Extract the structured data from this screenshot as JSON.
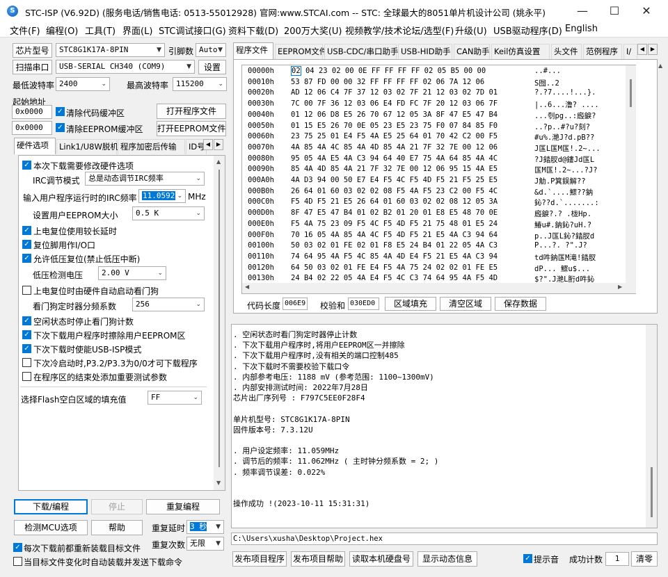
{
  "title": "STC-ISP (V6.92D) (服务电话/销售电话: 0513-55012928) 官网:www.STCAI.com  -- STC: 全球最大的8051单片机设计公司 (姚永平)",
  "menu": [
    "文件(F)",
    "编程(O)",
    "工具(T)",
    "界面(L)",
    "STC调试接口(G)",
    "资料下载(D)",
    "200万大奖(U)",
    "视频教学/技术论坛/选型(F)",
    "升级(U)",
    "USB驱动程序(D)",
    "English"
  ],
  "left": {
    "chip_btn": "芯片型号",
    "chip_value": "STC8G1K17A-8PIN",
    "pins_label": "引脚数",
    "pins_value": "Auto",
    "scan_btn": "扫描串口",
    "port_value": "USB-SERIAL CH340 (COM9)",
    "settings_btn": "设置",
    "min_baud_label": "最低波特率",
    "min_baud": "2400",
    "max_baud_label": "最高波特率",
    "max_baud": "115200",
    "start_addr_label": "起始地址",
    "addr1": "0x0000",
    "clear_code": "清除代码缓冲区",
    "open_prog": "打开程序文件",
    "addr2": "0x0000",
    "clear_eeprom": "清除EEPROM缓冲区",
    "open_eeprom": "打开EEPROM文件",
    "tabs": [
      "硬件选项",
      "Link1/U8W脱机",
      "程序加密后传输",
      "ID号"
    ],
    "hw": {
      "opt1": "本次下载需要修改硬件选项",
      "irc_mode_label": "IRC调节模式",
      "irc_mode": "总是动态调节IRC频率",
      "irc_freq_label": "输入用户程序运行时的IRC频率",
      "irc_freq": "11.0592",
      "mhz": "MHz",
      "eeprom_label": "设置用户EEPROM大小",
      "eeprom": "0.5 K",
      "opt2": "上电复位使用较长延时",
      "opt3": "复位脚用作I/O口",
      "opt4": "允许低压复位(禁止低压中断)",
      "lv_label": "低压检测电压",
      "lv": "2.00 V",
      "opt5": "上电复位时由硬件自动启动看门狗",
      "wdt_label": "看门狗定时器分频系数",
      "wdt": "256",
      "opt6": "空闲状态时停止看门狗计数",
      "opt7": "下次下载用户程序时擦除用户EEPROM区",
      "opt8": "下次下载时使能USB-ISP模式",
      "opt9": "下次冷启动时,P3.2/P3.3为0/0才可下载程序",
      "opt10": "在程序区的结束处添加重要测试参数",
      "fill_label": "选择Flash空白区域的填充值",
      "fill": "FF"
    },
    "download_btn": "下载/编程",
    "stop_btn": "停止",
    "reprog_btn": "重复编程",
    "check_btn": "检测MCU选项",
    "help_btn": "帮助",
    "delay_label": "重复延时",
    "delay": "3 秒",
    "count_label": "重复次数",
    "count": "无限",
    "reload": "每次下载前都重新装载目标文件",
    "autosend": "当目标文件变化时自动装载并发送下载命令"
  },
  "right": {
    "tabs": [
      "程序文件",
      "EEPROM文件",
      "USB-CDC/串口助手",
      "USB-HID助手",
      "CAN助手",
      "Keil仿真设置",
      "头文件",
      "范例程序",
      "I/"
    ],
    "hex": [
      [
        "00000h",
        "02 04 23 02 00 0E FF FF FF FF 02 05 B5 00 00",
        "..#..."
      ],
      [
        "00010h",
        "53 87 FD 00 00 32 FF FF FF FF 02 06 7A 12 06",
        "S囫..2"
      ],
      [
        "00020h",
        "AD 12 06 C4 7F 37 12 03 02 7F 21 12 03 02 7D 01",
        "?.?7....!...}."
      ],
      [
        "00030h",
        "7C 00 7F 36 12 03 06 E4 FD FC 7F 20 12 03 06 7F",
        "|..6...澛? ...."
      ],
      [
        "00040h",
        "01 12 06 D8 E5 26 70 67 12 05 3A 8F 47 E5 47 B4",
        "...刳pg..:廏錑?"
      ],
      [
        "00050h",
        "01 15 E5 26 70 0E 05 23 E5 23 75 F0 07 84 85 F0",
        "..?p..#?u?刻?"
      ],
      [
        "00060h",
        "23 75 25 01 E4 F5 4A E5 25 64 01 70 42 C2 00 F5",
        "#u%.滟J?d.pB??"
      ],
      [
        "00070h",
        "4A 85 4A 4C 85 4A 4D 85 4A 21 7F 32 7E 00 12 06",
        "J匤L匤M匤!.2~..."
      ],
      [
        "00080h",
        "95 05 4A E5 4A C3 94 64 40 E7 75 4A 64 85 4A 4C",
        "?J錔肞d@鏤Jd匤L"
      ],
      [
        "00090h",
        "85 4A 4D 85 4A 21 7F 32 7E 00 12 06 95 15 4A E5",
        "匤M匤!.2~...?J?"
      ],
      [
        "000A0h",
        "4A D3 94 00 50 E7 E4 F5 4C F5 4D F5 21 F5 25 E5",
        "J觔.P箕鋘解??"
      ],
      [
        "000B0h",
        "26 64 01 60 03 02 02 08 F5 4A F5 23 C2 00 F5 4C",
        "&d.`....鰥??鈉"
      ],
      [
        "000C0h",
        "F5 4D F5 21 E5 26 64 01 60 03 02 02 08 12 05 3A",
        "鈊??d.`.......:"
      ],
      [
        "000D0h",
        "8F 47 E5 47 B4 01 02 B2 01 20 01 E8 E5 48 70 0E",
        "廏錑?.? .栊Hp."
      ],
      [
        "000E0h",
        "F5 4A 75 23 09 F5 4C F5 4D F5 21 75 48 01 E5 24",
        "鰆u#.鈉鈊?uH.?"
      ],
      [
        "000F0h",
        "70 16 05 4A 85 4A 4C F5 4D F5 21 E5 4A C3 94 64",
        "p..J匤L鈊?錔肞d"
      ],
      [
        "00100h",
        "50 03 02 01 FE 02 01 F8 E5 24 B4 01 22 05 4A C3",
        "P...?.  ?\".J?"
      ],
      [
        "00110h",
        "74 64 95 4A F5 4C 85 4A 4D E4 F5 21 E5 4A C3 94",
        "td吽鈉匤M滝!錔肞"
      ],
      [
        "00120h",
        "64 50 03 02 01 FE E4 F5 4A 75 24 02 02 01 FE E5",
        "dP...  鰥u$..."
      ],
      [
        "00130h",
        "24 B4 02 22 05 4A E4 F5 4C C3 74 64 95 4A F5 4D",
        "$?\".J滟L胻d吽鈊"
      ]
    ],
    "code_len_label": "代码长度",
    "code_len": "006E9",
    "checksum_label": "校验和",
    "checksum": "030ED0",
    "fill_btn": "区域填充",
    "clear_btn": "清空区域",
    "save_btn": "保存数据",
    "log": [
      ". 空闲状态时看门狗定时器停止计数",
      ". 下次下载用户程序时,将用户EEPROM区一并擦除",
      ". 下次下载用户程序时,没有相关的端口控制485",
      ". 下次下载时不需要校验下载口令",
      ". 内部参考电压: 1188 mV (参考范围: 1100~1300mV)",
      ". 内部安排测试时间: 2022年7月28日",
      "芯片出厂序列号 : F797C5EE0F28F4",
      "",
      "  单片机型号: STC8G1K17A-8PIN",
      "  固件版本号: 7.3.12U",
      "",
      ". 用户设定频率: 11.059MHz",
      ". 调节后的频率: 11.062MHz ( 主时钟分频系数 = 2; )",
      ". 频率调节误差: 0.022%",
      "",
      "",
      "操作成功 !(2023-10-11 15:31:31)"
    ],
    "path": "C:\\Users\\xusha\\Desktop\\Project.hex",
    "publish_btn": "发布项目程序",
    "publish_help_btn": "发布项目帮助",
    "read_disk_btn": "读取本机硬盘号",
    "show_info_btn": "显示动态信息",
    "sound_label": "提示音",
    "success_label": "成功计数",
    "success_count": "1",
    "clear_count_btn": "清零"
  }
}
